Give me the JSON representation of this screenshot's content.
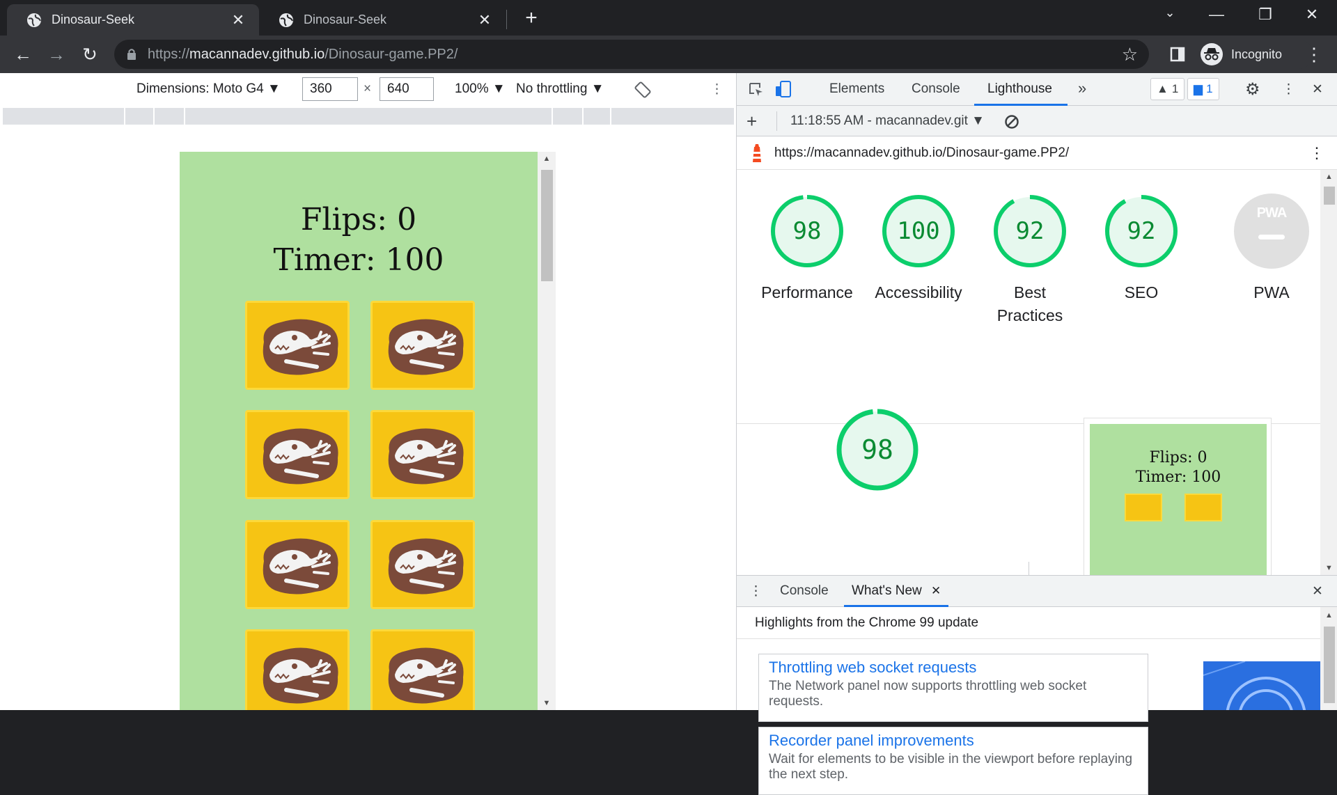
{
  "browser": {
    "tabs": [
      {
        "title": "Dinosaur-Seek",
        "active": true
      },
      {
        "title": "Dinosaur-Seek",
        "active": false
      }
    ],
    "url_scheme": "https://",
    "url_host": "macannadev.github.io",
    "url_path": "/Dinosaur-game.PP2/",
    "profile_label": "Incognito"
  },
  "device_toolbar": {
    "dimensions_label": "Dimensions: Moto G4",
    "width_value": "360",
    "times": "×",
    "height_value": "640",
    "zoom_label": "100%",
    "throttle_label": "No throttling"
  },
  "game": {
    "flips_label": "Flips:",
    "flips_value": "0",
    "timer_label": "Timer:",
    "timer_value": "100",
    "card_count": 8
  },
  "devtools": {
    "tabs": [
      "Elements",
      "Console",
      "Lighthouse"
    ],
    "active_tab": "Lighthouse",
    "more_tabs": "»",
    "warnings_count": "1",
    "messages_count": "1",
    "report_selector": "11:18:55 AM - macannadev.git",
    "report_url": "https://macannadev.github.io/Dinosaur-game.PP2/",
    "scores": [
      {
        "value": "98",
        "label": "Performance",
        "fraction": 0.98
      },
      {
        "value": "100",
        "label": "Accessibility",
        "fraction": 1.0
      },
      {
        "value": "92",
        "label": "Best Practices",
        "fraction": 0.92
      },
      {
        "value": "92",
        "label": "SEO",
        "fraction": 0.92
      }
    ],
    "pwa": {
      "badge": "PWA",
      "label": "PWA"
    },
    "big_score": {
      "value": "98",
      "fraction": 0.98
    },
    "thumb_flips": "Flips: 0",
    "thumb_timer": "Timer: 100",
    "score_color": "#0cce6b"
  },
  "drawer": {
    "tabs": [
      "Console",
      "What's New"
    ],
    "active_tab": "What's New",
    "highlight": "Highlights from the Chrome 99 update",
    "features": [
      {
        "title": "Throttling web socket requests",
        "desc": "The Network panel now supports throttling web socket requests."
      },
      {
        "title": "Recorder panel improvements",
        "desc": "Wait for elements to be visible in the viewport before replaying the next step."
      }
    ]
  }
}
